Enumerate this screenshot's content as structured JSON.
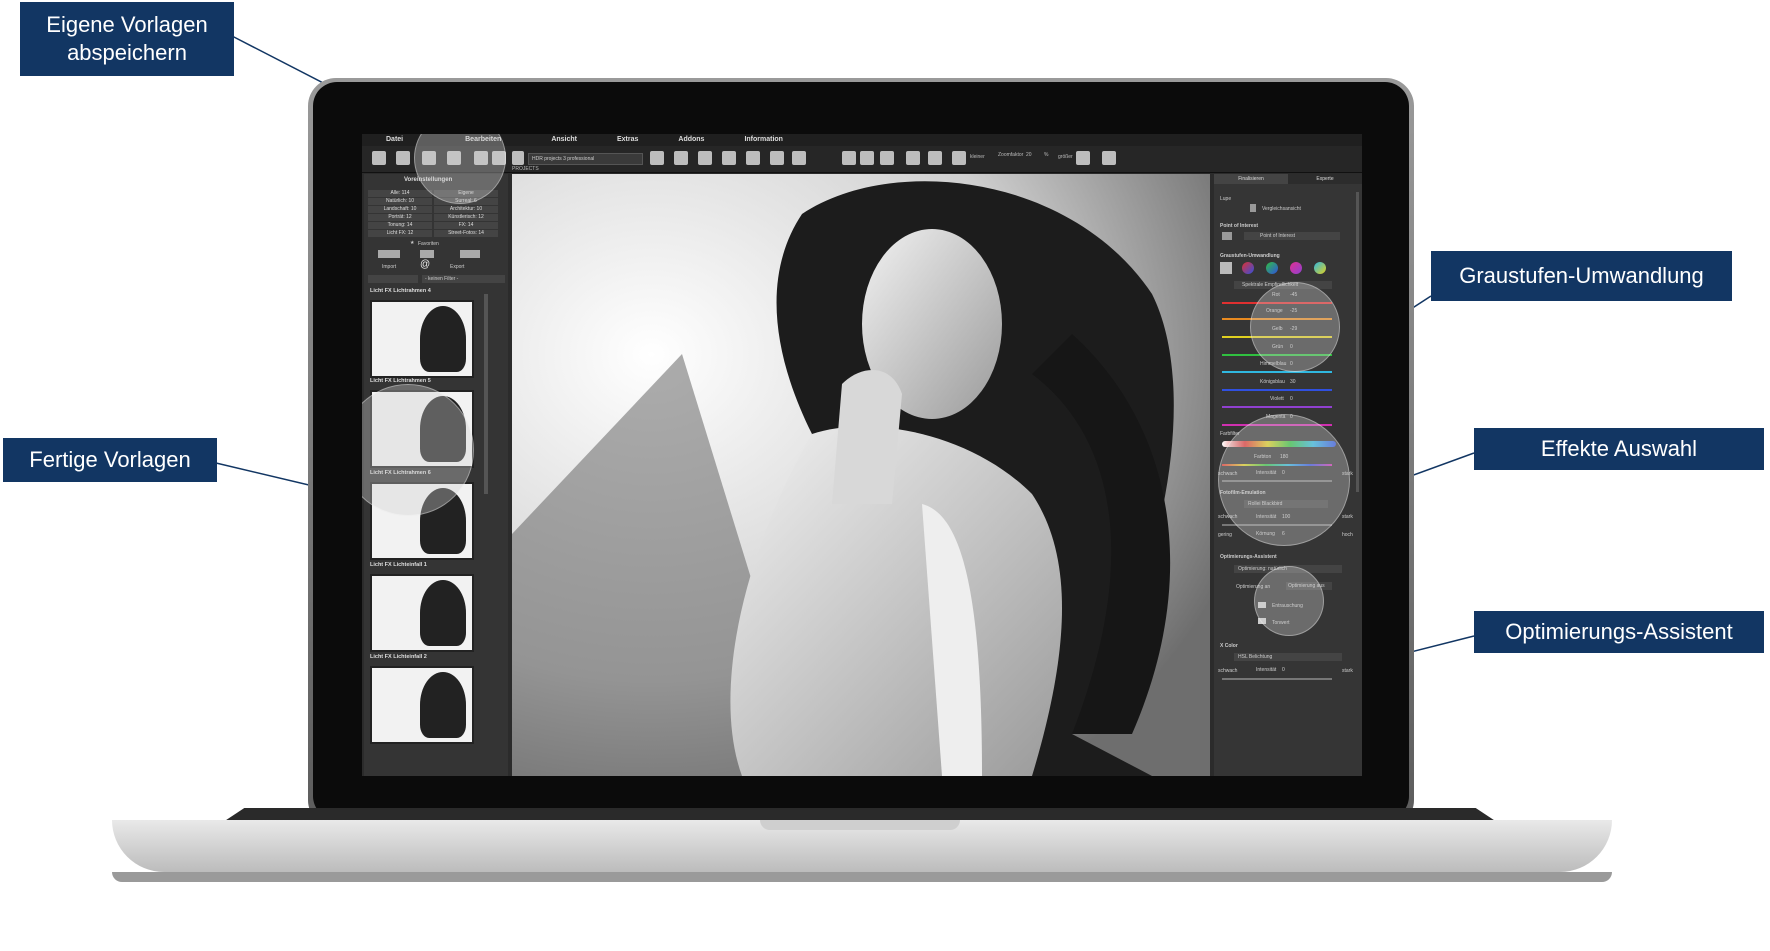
{
  "callouts": {
    "eigene_vorlagen": "Eigene Vorlagen abspeichern",
    "fertige_vorlagen": "Fertige Vorlagen",
    "graustufen": "Graustufen-Umwandlung",
    "effekte": "Effekte Auswahl",
    "optimierung": "Optimierungs-Assistent"
  },
  "app": {
    "menu": [
      "Datei",
      "Bearbeiten",
      "Ansicht",
      "Extras",
      "Addons",
      "Information"
    ],
    "toolbar": {
      "preset_select": "HDR projects 3 professional",
      "projects_label": "PROJECTS",
      "kleiner": "kleiner",
      "zoomfaktor_label": "Zoomfaktor",
      "zoom_value": "20",
      "zoom_unit": "%",
      "groesser": "größer"
    },
    "left_panel": {
      "title": "Voreinstellungen",
      "categories": [
        [
          "Alle: 114",
          "Eigene"
        ],
        [
          "Natürlich: 10",
          "Surreal: 6"
        ],
        [
          "Landschaft: 10",
          "Architektur: 10"
        ],
        [
          "Porträt: 12",
          "Künstlerisch: 12"
        ],
        [
          "Tonung: 14",
          "FX: 14"
        ],
        [
          "Licht FX: 12",
          "Street-Fotos: 14"
        ]
      ],
      "favoriten": "Favoriten",
      "import": "Import",
      "export": "Export",
      "filter_select": "- keinen Filter -",
      "presets": [
        "Licht FX Lichtrahmen 4",
        "Licht FX Lichtrahmen 5",
        "Licht FX Lichtrahmen 6",
        "Licht FX Lichteinfall 1",
        "Licht FX Lichteinfall 2"
      ]
    },
    "right_panel": {
      "tabs": [
        "Finalisieren",
        "Experte"
      ],
      "lupe": "Lupe",
      "vergleichsansicht": "Vergleichsansicht",
      "poi_title": "Point of Interest",
      "poi_button": "Point of Interest",
      "graustufen_title": "Graustufen-Umwandlung",
      "spektral": "Spektrale Empfindlichkeit",
      "channels": [
        {
          "label": "Rot",
          "value": "-45",
          "color": "#e03030"
        },
        {
          "label": "Orange",
          "value": "-25",
          "color": "#e88a20"
        },
        {
          "label": "Gelb",
          "value": "-29",
          "color": "#e0d020"
        },
        {
          "label": "Grün",
          "value": "0",
          "color": "#30c040"
        },
        {
          "label": "Himmelblau",
          "value": "0",
          "color": "#30b8e0"
        },
        {
          "label": "Königsblau",
          "value": "30",
          "color": "#3050e0"
        },
        {
          "label": "Violett",
          "value": "0",
          "color": "#9040d0"
        },
        {
          "label": "Magenta",
          "value": "0",
          "color": "#d030b0"
        }
      ],
      "percent": "%",
      "farbfilter": "Farbfilter",
      "farbton_label": "Farbton",
      "farbton_value": "180",
      "intensitaet_label": "Intensität",
      "intensitaet_value": "0",
      "schwach": "schwach",
      "stark": "stark",
      "fotofilm_title": "Fotofilm-Emulation",
      "film_select": "Rollei Blackbird",
      "film_intensitaet": "100",
      "koernung_label": "Körnung",
      "koernung_value": "6",
      "gering": "gering",
      "hoch": "hoch",
      "optimierung_title": "Optimierungs-Assistent",
      "optimierung_select": "Optimierung: natürlich",
      "optimierung_an": "Optimierung an",
      "optimierung_aus": "Optimierung aus",
      "entrauschung": "Entrauschung",
      "tonwert": "Tonwert",
      "xcolor_title": "X Color",
      "hsl_select": "HSL Belichtung",
      "xcolor_intensitaet": "0"
    }
  }
}
